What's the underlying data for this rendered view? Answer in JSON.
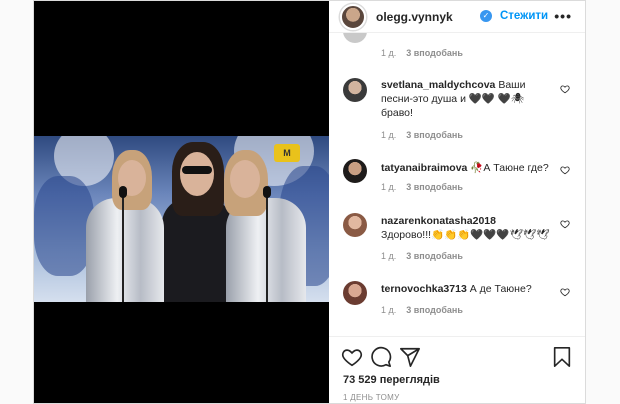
{
  "post": {
    "video": {
      "channel_logo": "M"
    },
    "header": {
      "username": "olegg.vynnyk",
      "follow_label": "Стежити",
      "more_label": "•••"
    },
    "comments": [
      {
        "meta_time": "1 д.",
        "meta_likes": "3 вподобань"
      },
      {
        "username": "svetlana_maldychcova",
        "text": "Ваши песни-это душа и 🖤🖤 🖤🕷 браво!",
        "meta_time": "1 д.",
        "meta_likes": "3 вподобань"
      },
      {
        "username": "tatyanaibraimova",
        "text": "🥀А Таюне где?",
        "meta_time": "1 д.",
        "meta_likes": "3 вподобань"
      },
      {
        "username": "nazarenkonatasha2018",
        "text": "Здорово!!!👏👏👏🖤🖤🖤🕊🕊🕊",
        "meta_time": "1 д.",
        "meta_likes": "3 вподобань"
      },
      {
        "username": "ternovochka3713",
        "text": "А де Таюне?",
        "meta_time": "1 д.",
        "meta_likes": "3 вподобань"
      }
    ],
    "views": "73 529 переглядів",
    "timestamp": "1 день тому",
    "colors": {
      "link": "#0095f6",
      "muted": "#8e8e8e",
      "text": "#262626",
      "verified": "#3897f0"
    },
    "icons": [
      "like-icon",
      "comment-icon",
      "share-icon",
      "save-icon",
      "heart-icon",
      "verified-badge-icon"
    ]
  }
}
